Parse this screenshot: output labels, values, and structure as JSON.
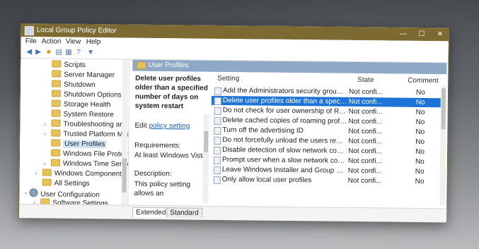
{
  "window": {
    "title": "Local Group Policy Editor",
    "controls": {
      "minimize": "—",
      "maximize": "☐",
      "close": "✕"
    }
  },
  "menu": {
    "items": [
      "File",
      "Action",
      "View",
      "Help"
    ]
  },
  "toolbar": {
    "icons": [
      "back-arrow-icon",
      "forward-arrow-icon",
      "folder-up-icon",
      "show-hide-tree-icon",
      "properties-icon",
      "help-icon",
      "filter-icon"
    ]
  },
  "tree": {
    "items": [
      {
        "label": "Scripts"
      },
      {
        "label": "Server Manager"
      },
      {
        "label": "Shutdown"
      },
      {
        "label": "Shutdown Options"
      },
      {
        "label": "Storage Health"
      },
      {
        "label": "System Restore"
      },
      {
        "label": "Troubleshooting and Di"
      },
      {
        "label": "Trusted Platform Modu"
      },
      {
        "label": "User Profiles"
      },
      {
        "label": "Windows File Protectio"
      },
      {
        "label": "Windows Time Service"
      },
      {
        "label": "Windows Components"
      },
      {
        "label": "All Settings"
      },
      {
        "label": "User Configuration"
      },
      {
        "label": "Software Settings"
      }
    ]
  },
  "header": {
    "title": "User Profiles"
  },
  "description": {
    "title": "Delete user profiles older than a specified number of days on system restart",
    "edit_prefix": "Edit",
    "edit_link": "policy setting",
    "requirements_label": "Requirements:",
    "requirements_value": "At least Windows Vista",
    "description_label": "Description:",
    "body": "This policy setting allows an"
  },
  "columns": {
    "setting": "Setting",
    "state": "State",
    "comment": "Comment"
  },
  "rows": [
    {
      "setting": "Add the Administrators security group to...",
      "state": "Not confi...",
      "comment": "No"
    },
    {
      "setting": "Delete user profiles older than a specifie...",
      "state": "Not confi...",
      "comment": "No"
    },
    {
      "setting": "Do not check for user ownership of Roa...",
      "state": "Not confi...",
      "comment": "No"
    },
    {
      "setting": "Delete cached copies of roaming profiles",
      "state": "Not confi...",
      "comment": "No"
    },
    {
      "setting": "Turn off the advertising ID",
      "state": "Not confi...",
      "comment": "No"
    },
    {
      "setting": "Do not forcefully unload the users registr...",
      "state": "Not confi...",
      "comment": "No"
    },
    {
      "setting": "Disable detection of slow network conne...",
      "state": "Not confi...",
      "comment": "No"
    },
    {
      "setting": "Prompt user when a slow network conne...",
      "state": "Not confi...",
      "comment": "No"
    },
    {
      "setting": "Leave Windows Installer and Group Polic...",
      "state": "Not confi...",
      "comment": "No"
    },
    {
      "setting": "Only allow local user profiles",
      "state": "Not confi...",
      "comment": "No"
    }
  ],
  "tabs": [
    "Extended",
    "Standard"
  ],
  "colors": {
    "titlebar": "#7d6a33",
    "header_band": "#8fa8c8",
    "selected_row": "#1d74d6"
  }
}
